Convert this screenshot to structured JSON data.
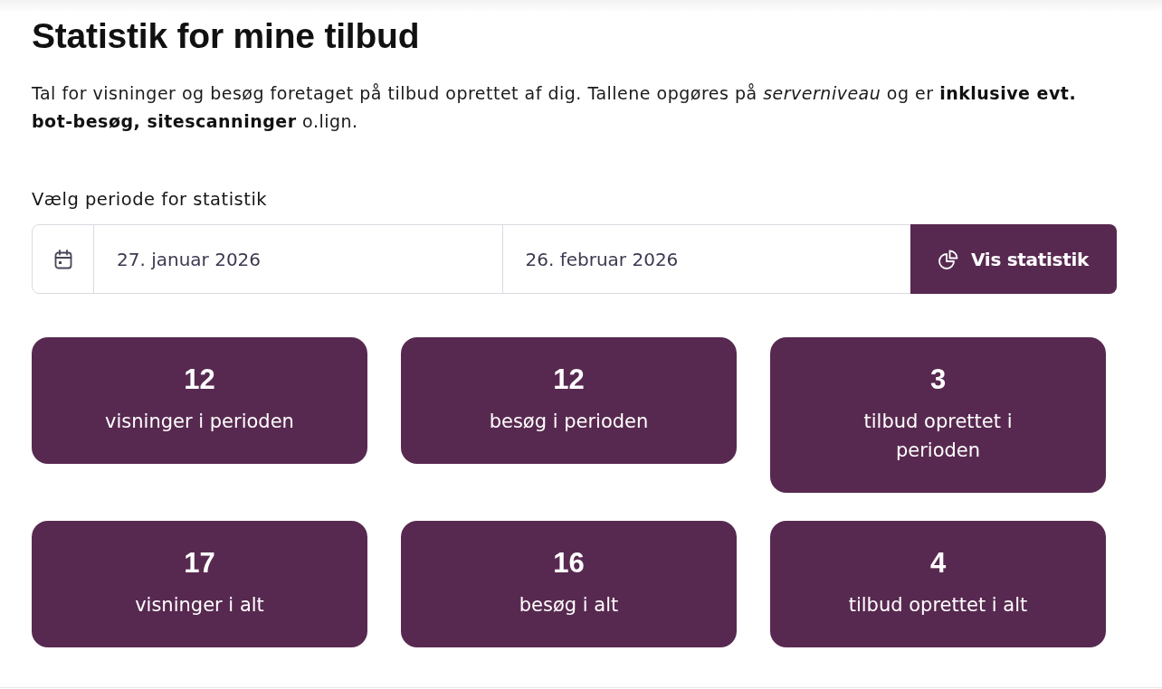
{
  "title": "Statistik for mine tilbud",
  "intro": "Tal for visninger og besøg foretaget på tilbud oprettet af dig. Tallene opgøres på *serverniveau* og er **inklusive evt. bot-besøg, sitescanninger** o.lign.",
  "period": {
    "label": "Vælg periode for statistik",
    "start_date": "27. januar 2026",
    "end_date": "26. februar 2026",
    "button": "Vis statistik"
  },
  "stats": [
    {
      "value": "12",
      "label": "visninger i perioden"
    },
    {
      "value": "12",
      "label": "besøg i perioden"
    },
    {
      "value": "3",
      "label": "tilbud oprettet i perioden"
    },
    {
      "value": "17",
      "label": "visninger i alt"
    },
    {
      "value": "16",
      "label": "besøg i alt"
    },
    {
      "value": "4",
      "label": "tilbud oprettet i alt"
    }
  ]
}
